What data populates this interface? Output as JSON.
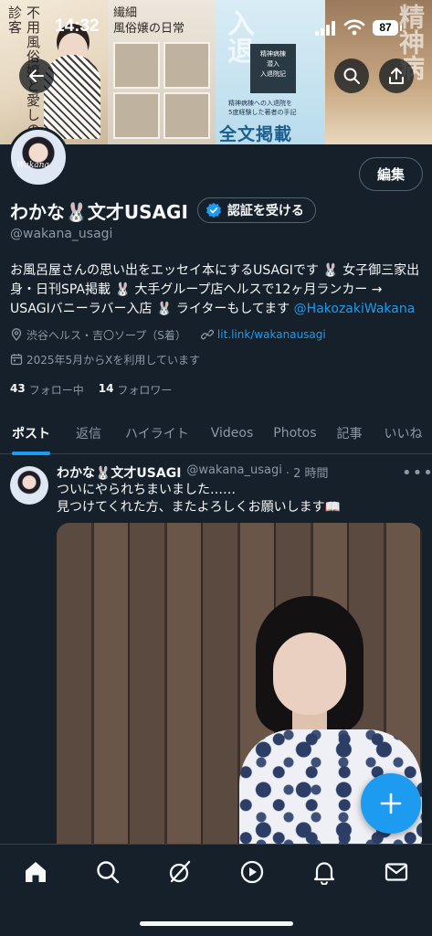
{
  "status_bar": {
    "time": "14:32",
    "battery": "87"
  },
  "banner": {
    "panel1_text": "不用風俗嬢と愛しの診客",
    "panel2_title": "繊細\n風俗嬢の日常",
    "panel3_box": "精神病棟\n潜入\n入退院記",
    "panel3_small": "精神病棟への入退院を\n5度経験した著者の手記",
    "panel3_big": "全文掲載",
    "panel3_vertical": "入退",
    "panel4_vertical": "精神病"
  },
  "profile": {
    "name": "わかな🐰文才USAGI",
    "handle": "@wakana_usagi",
    "edit_label": "編集",
    "verify_label": "認証を受ける",
    "avatar_watermark": "Wakana",
    "bio_text": "お風呂屋さんの思い出をエッセイ本にするUSAGIです 🐰 女子御三家出身・日刊SPA掲載 🐰 大手グループ店ヘルスで12ヶ月ランカー → USAGIバニーラバー入店 🐰 ライターもしてます ",
    "bio_mention": "@HakozakiWakana",
    "location": "渋谷ヘルス・吉〇ソープ（S着）",
    "website": "lit.link/wakanausagi",
    "joined": "2025年5月からXを利用しています",
    "following_count": "43",
    "following_label": "フォロー中",
    "followers_count": "14",
    "followers_label": "フォロワー"
  },
  "tabs": [
    "ポスト",
    "返信",
    "ハイライト",
    "Videos",
    "Photos",
    "記事",
    "いいね"
  ],
  "post": {
    "name": "わかな🐰文才USAGI",
    "handle": "@wakana_usagi",
    "time": "· 2 時間",
    "line1": "ついにやられちまいました……",
    "line2": "見つけてくれた方、またよろしくお願いします📖"
  },
  "colors": {
    "accent": "#1d9bf0",
    "background": "#15202b",
    "muted": "#8b98a5",
    "border": "#38444d"
  },
  "icons": {
    "back": "arrow-left-icon",
    "search": "search-icon",
    "share": "share-icon",
    "verified": "verified-badge-icon",
    "location": "location-pin-icon",
    "link": "link-icon",
    "calendar": "calendar-icon",
    "nav": [
      "home-icon",
      "search-icon",
      "grok-icon",
      "video-icon",
      "bell-icon",
      "mail-icon"
    ],
    "compose": "plus-icon"
  }
}
